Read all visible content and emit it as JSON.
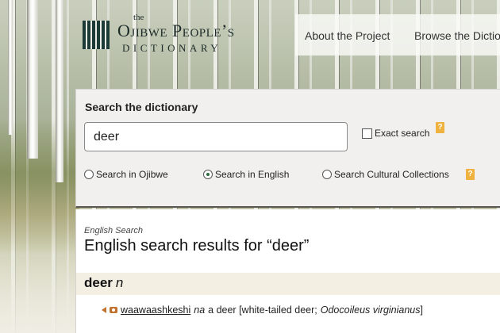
{
  "logo": {
    "the": "the",
    "title": "Ojibwe People’s",
    "subtitle": "DICTIONARY"
  },
  "nav": {
    "items": [
      "About the Project",
      "Browse the Dictio"
    ]
  },
  "search": {
    "heading": "Search the dictionary",
    "input_value": "deer",
    "exact_label": "Exact search",
    "help_glyph": "?",
    "options": [
      "Search in Ojibwe",
      "Search in English",
      "Search Cultural Collections"
    ],
    "selected_option": "Search in English"
  },
  "results": {
    "label": "English Search",
    "title": "English search results for “deer”",
    "entry": {
      "headword": "deer",
      "pos": "n",
      "ojibwe_word": "waawaashkeshi",
      "word_class": "na",
      "gloss_prefix": "a deer [white-tailed deer;",
      "scientific_name": "Odocoileus virginianus",
      "gloss_suffix": "]"
    }
  },
  "colors": {
    "accent": "#f0b23e",
    "brand_dark": "#1c3a36",
    "entry_band": "#f3efe3",
    "audio_icon": "#c0722e"
  },
  "icons": {
    "help": "question-mark-icon",
    "audio": "speaker-icon",
    "media": "camera-icon"
  }
}
